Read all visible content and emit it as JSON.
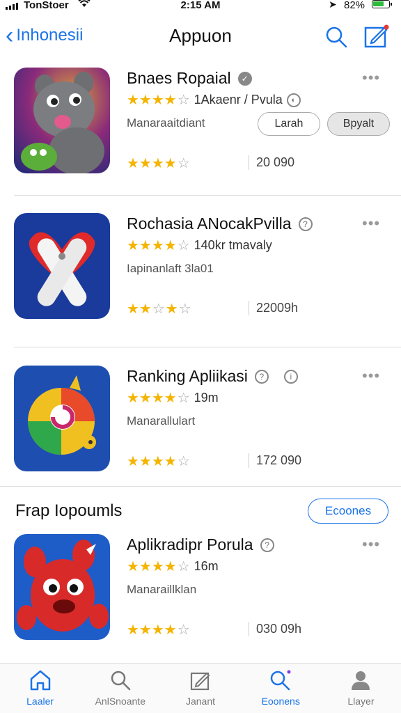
{
  "status_bar": {
    "carrier": "TonStoer",
    "time": "2:15 AM",
    "battery": "82%"
  },
  "nav": {
    "back_label": "Inhonesii",
    "title": "Appuon"
  },
  "apps": [
    {
      "name": "Bnaes Ropaial",
      "rating_text": "1Akaenr / Pvula",
      "subtitle": "Manaraaitdiant",
      "count": "20 090",
      "button_1": "Larah",
      "button_2": "Bpyalt"
    },
    {
      "name": "Rochasia ANocakPvilla",
      "rating_text": "140kr tmavaly",
      "subtitle": "Iapinanlaft 3la01",
      "count": "22009h"
    },
    {
      "name": "Ranking Apliikasi",
      "rating_text": "19m",
      "subtitle": "Manarallulart",
      "count": "172 090"
    },
    {
      "name": "Aplikradipr Porula",
      "rating_text": "16m",
      "subtitle": "Manaraillklan",
      "count": "030 09h"
    }
  ],
  "section": {
    "title": "Frap Iopoumls",
    "button": "Ecoones"
  },
  "tabs": [
    {
      "label": "Laaler",
      "icon": "home-icon"
    },
    {
      "label": "AnlSnoante",
      "icon": "search-icon"
    },
    {
      "label": "Janant",
      "icon": "edit-icon"
    },
    {
      "label": "Eoonens",
      "icon": "search-icon"
    },
    {
      "label": "Llayer",
      "icon": "person-icon"
    }
  ],
  "colors": {
    "accent": "#1a73e8",
    "star": "#f4b400",
    "battery": "#2dbb3a"
  }
}
